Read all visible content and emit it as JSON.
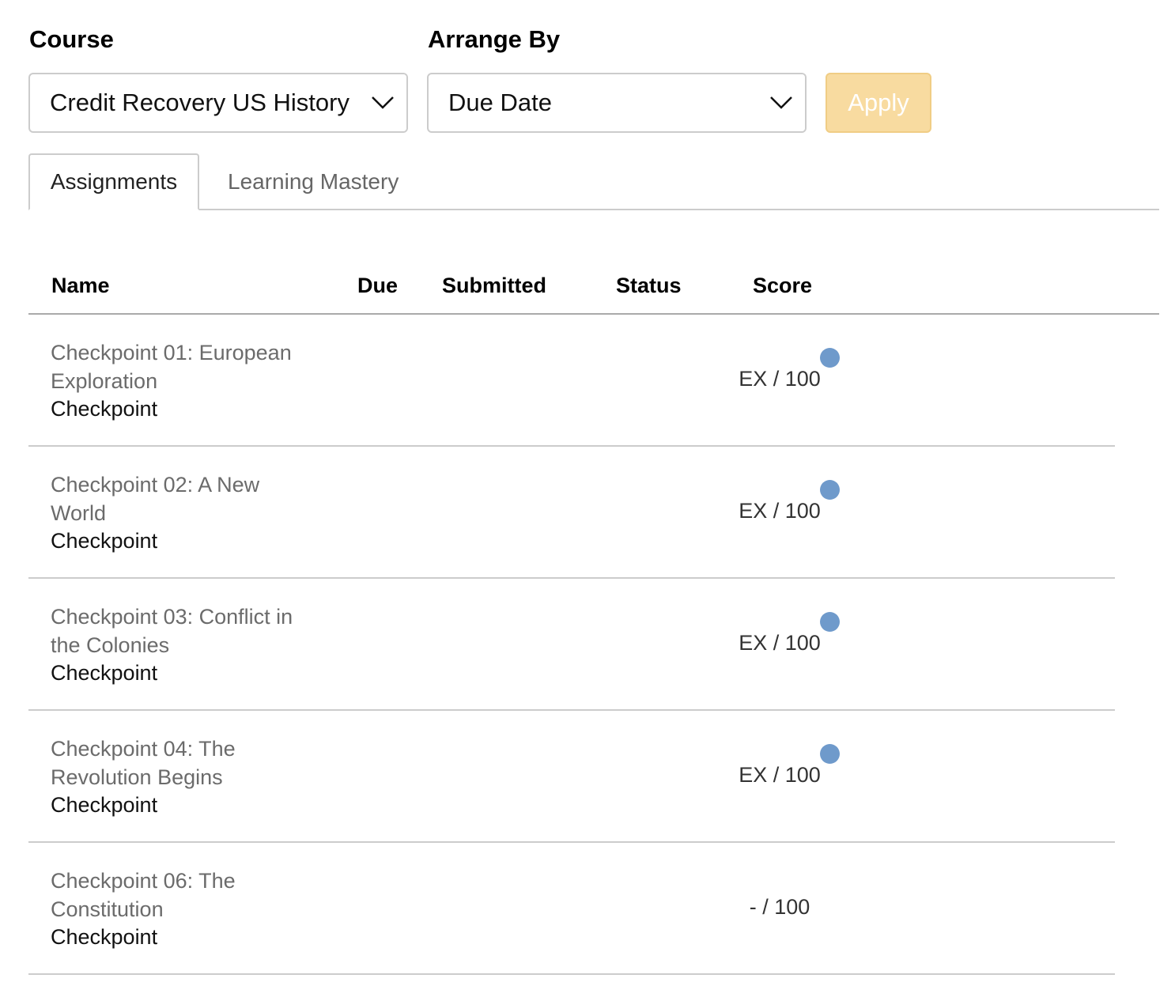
{
  "filters": {
    "course_label": "Course",
    "course_value": "Credit Recovery US History",
    "arrange_label": "Arrange By",
    "arrange_value": "Due Date",
    "apply_label": "Apply"
  },
  "tabs": [
    {
      "label": "Assignments",
      "active": true
    },
    {
      "label": "Learning Mastery",
      "active": false
    }
  ],
  "table": {
    "headers": {
      "name": "Name",
      "due": "Due",
      "submitted": "Submitted",
      "status": "Status",
      "score": "Score"
    },
    "rows": [
      {
        "name": "Checkpoint 01: European Exploration",
        "type": "Checkpoint",
        "score": "EX / 100",
        "indicator": true
      },
      {
        "name": "Checkpoint 02: A New World",
        "type": "Checkpoint",
        "score": "EX / 100",
        "indicator": true
      },
      {
        "name": "Checkpoint 03: Conflict in the Colonies",
        "type": "Checkpoint",
        "score": "EX / 100",
        "indicator": true
      },
      {
        "name": "Checkpoint 04: The Revolution Begins",
        "type": "Checkpoint",
        "score": "EX / 100",
        "indicator": true
      },
      {
        "name": "Checkpoint 06: The Constitution",
        "type": "Checkpoint",
        "score": "- / 100",
        "indicator": false
      }
    ]
  },
  "colors": {
    "apply_bg": "#f8dba0",
    "indicator_dot": "#6f9acb"
  },
  "icons": {
    "dropdown": "chevron-down-icon"
  }
}
